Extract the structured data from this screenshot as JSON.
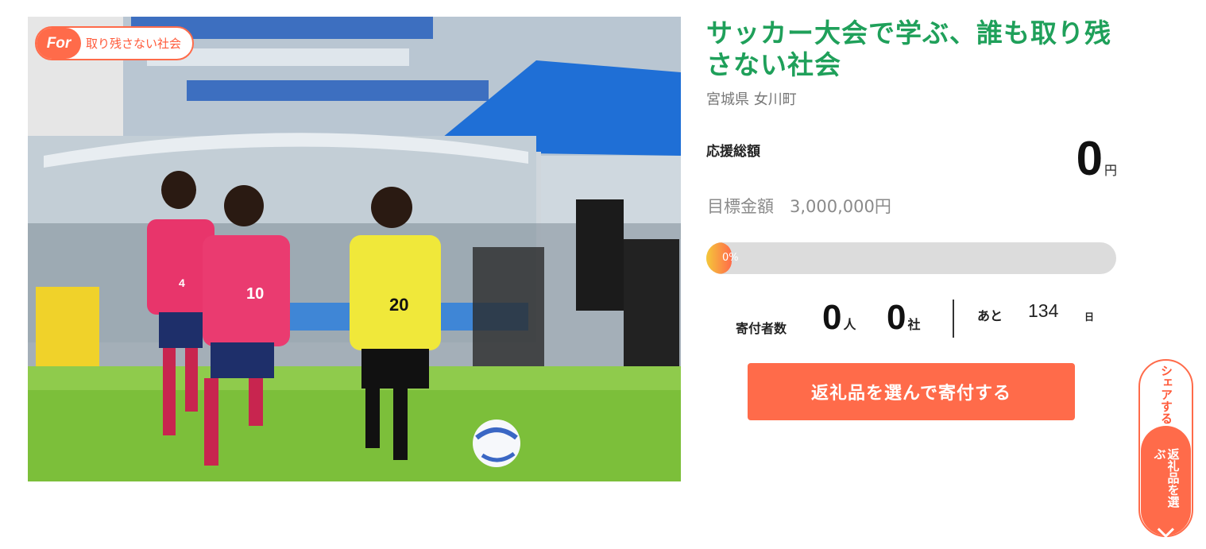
{
  "hero": {
    "badge_for": "For",
    "badge_text": "取り残さない社会",
    "jersey_numbers": [
      "4",
      "10",
      "20"
    ]
  },
  "project": {
    "title": "サッカー大会で学ぶ、誰も取り残さない社会",
    "location": "宮城県 女川町"
  },
  "support": {
    "label": "応援総額",
    "amount": "0",
    "unit": "円"
  },
  "goal": {
    "label": "目標金額",
    "amount": "3,000,000円"
  },
  "progress": {
    "percent_text": "0%",
    "percent": 0
  },
  "stats": {
    "donor_label": "寄付者数",
    "people_count": "0",
    "people_unit": "人",
    "company_count": "0",
    "company_unit": "社",
    "remain_label": "あと",
    "remain_days": "134",
    "remain_unit": "日"
  },
  "actions": {
    "donate_button": "返礼品を選んで寄付する",
    "share_label": "シェアする",
    "select_label": "返礼品を選ぶ"
  },
  "colors": {
    "accent": "#ff6b4a",
    "title_green": "#1fa05a",
    "progress_track": "#dcdcdc"
  },
  "icons": {
    "side_widget": "chevron-down-icon"
  }
}
